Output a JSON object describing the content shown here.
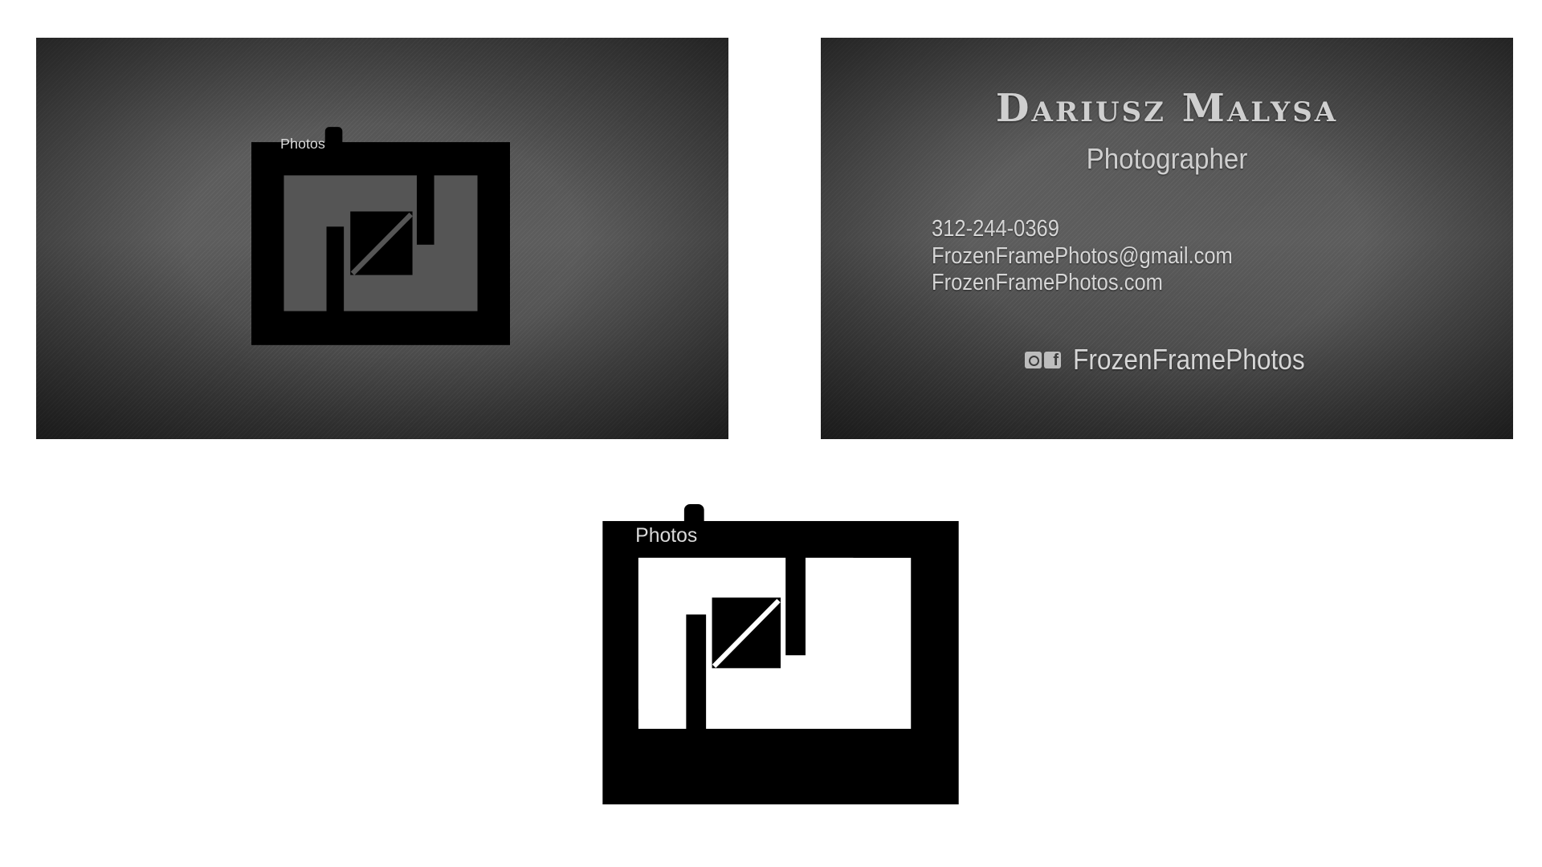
{
  "logo": {
    "label": "Photos"
  },
  "back": {
    "name": "Dariusz Malysa",
    "title": "Photographer",
    "phone": "312-244-0369",
    "email": "FrozenFramePhotos@gmail.com",
    "website": "FrozenFramePhotos.com",
    "social_handle": "FrozenFramePhotos",
    "social_icons": [
      "instagram-icon",
      "facebook-icon"
    ]
  },
  "colors": {
    "logo_black": "#000000",
    "logo_label_light": "#d9d9d9",
    "card_text": "#d6d6d6"
  }
}
